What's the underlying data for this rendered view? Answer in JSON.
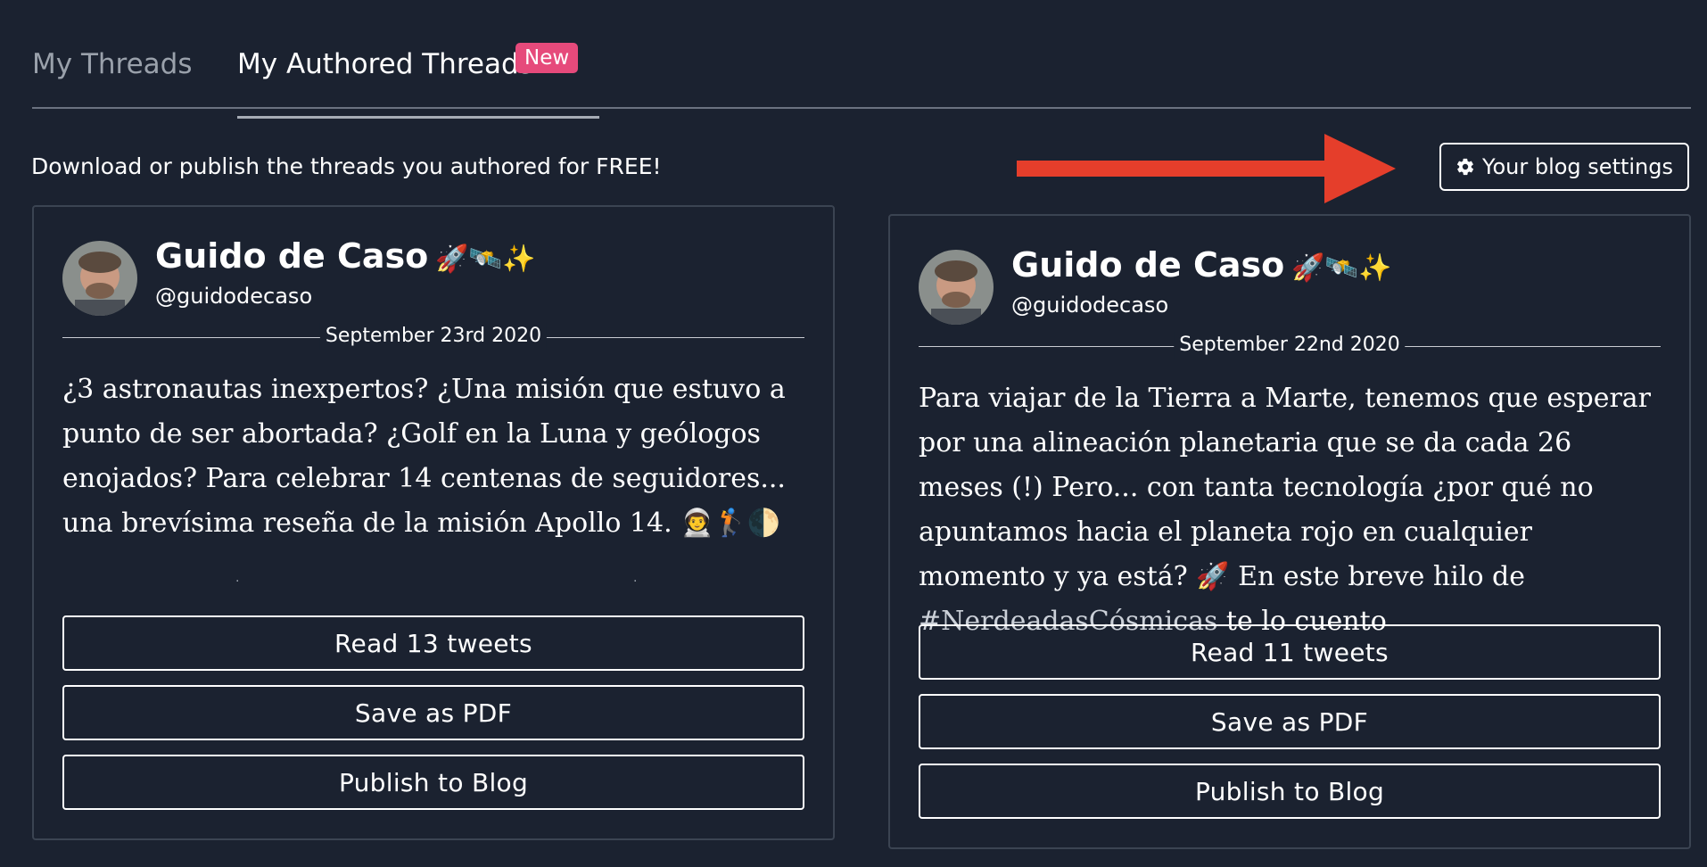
{
  "tabs": [
    {
      "label": "My Threads",
      "active": false
    },
    {
      "label": "My Authored Threads",
      "active": true,
      "badge": "New"
    }
  ],
  "subtitle": "Download or publish the threads you authored for FREE!",
  "settings_button": {
    "label": "Your blog settings",
    "icon": "gear-icon"
  },
  "annotation": {
    "arrow_color": "#e53e2b"
  },
  "colors": {
    "background": "#1b2230",
    "badge": "#e64a7b",
    "arrow": "#e53e2b"
  },
  "cards": [
    {
      "author": {
        "name": "Guido de Caso",
        "emoji": "🚀🛰️✨",
        "handle": "@guidodecaso"
      },
      "date": "September 23rd 2020",
      "text": "¿3 astronautas inexpertos? ¿Una misión que estuvo a punto de ser abortada? ¿Golf en la Luna y geólogos enojados? Para celebrar 14 centenas de seguidores... una brevísima reseña de la misión Apollo 14. 👨‍🚀🏌️🌓",
      "buttons": {
        "read": "Read 13 tweets",
        "pdf": "Save as PDF",
        "publish": "Publish to Blog"
      }
    },
    {
      "author": {
        "name": "Guido de Caso",
        "emoji": "🚀🛰️✨",
        "handle": "@guidodecaso"
      },
      "date": "September 22nd 2020",
      "text_before": "Para viajar de la Tierra a Marte, tenemos que esperar por una alineación planetaria que se da cada 26 meses (!) Pero... con tanta tecnología ¿por qué no apuntamos hacia el planeta rojo en cualquier momento y ya está? 🚀  En este breve hilo de ",
      "hashtag": "#NerdeadasCósmicas",
      "text_after": " te lo cuento",
      "buttons": {
        "read": "Read 11 tweets",
        "pdf": "Save as PDF",
        "publish": "Publish to Blog"
      }
    }
  ]
}
